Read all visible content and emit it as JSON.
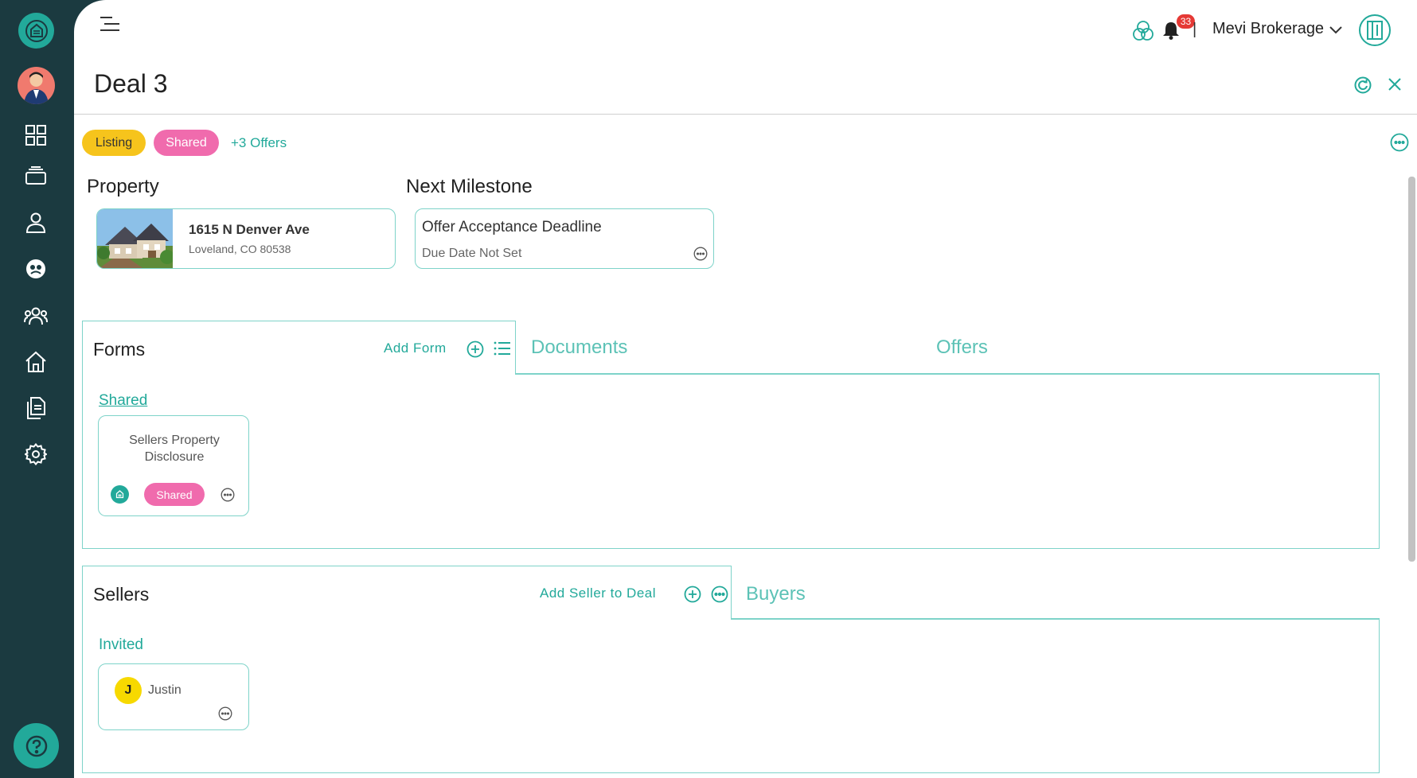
{
  "header": {
    "notification_count": "33",
    "separator": "|",
    "brokerage": "Mevi Brokerage"
  },
  "page": {
    "title": "Deal 3"
  },
  "tags": {
    "listing": "Listing",
    "shared": "Shared",
    "offers": "+3 Offers"
  },
  "property": {
    "label": "Property",
    "address": "1615 N Denver Ave",
    "city_state_zip": "Loveland,  CO  80538"
  },
  "milestone": {
    "label": "Next Milestone",
    "title": "Offer Acceptance Deadline",
    "due": "Due Date Not Set"
  },
  "forms_section": {
    "tabs": [
      {
        "label": "Forms",
        "active": true
      },
      {
        "label": "Documents",
        "active": false
      },
      {
        "label": "Offers",
        "active": false
      }
    ],
    "add_label": "Add Form",
    "group_label": "Shared",
    "cards": [
      {
        "name": "Sellers Property Disclosure",
        "status": "Shared"
      }
    ]
  },
  "people_section": {
    "tabs": [
      {
        "label": "Sellers",
        "active": true
      },
      {
        "label": "Buyers",
        "active": false
      }
    ],
    "add_label": "Add Seller to Deal",
    "group_label": "Invited",
    "sellers": [
      {
        "initial": "J",
        "name": "Justin"
      }
    ]
  },
  "colors": {
    "sidebar": "#1b3a40",
    "accent": "#22a99a",
    "listing_pill": "#f6c41c",
    "shared_pill": "#f06bad",
    "border": "#7ed3c9"
  },
  "icons": {
    "sidebar": [
      "brand-logo-icon",
      "user-avatar",
      "dashboard-icon",
      "stack-icon",
      "person-icon",
      "support-icon",
      "team-icon",
      "house-icon",
      "documents-icon",
      "gear-icon",
      "help-icon"
    ]
  }
}
